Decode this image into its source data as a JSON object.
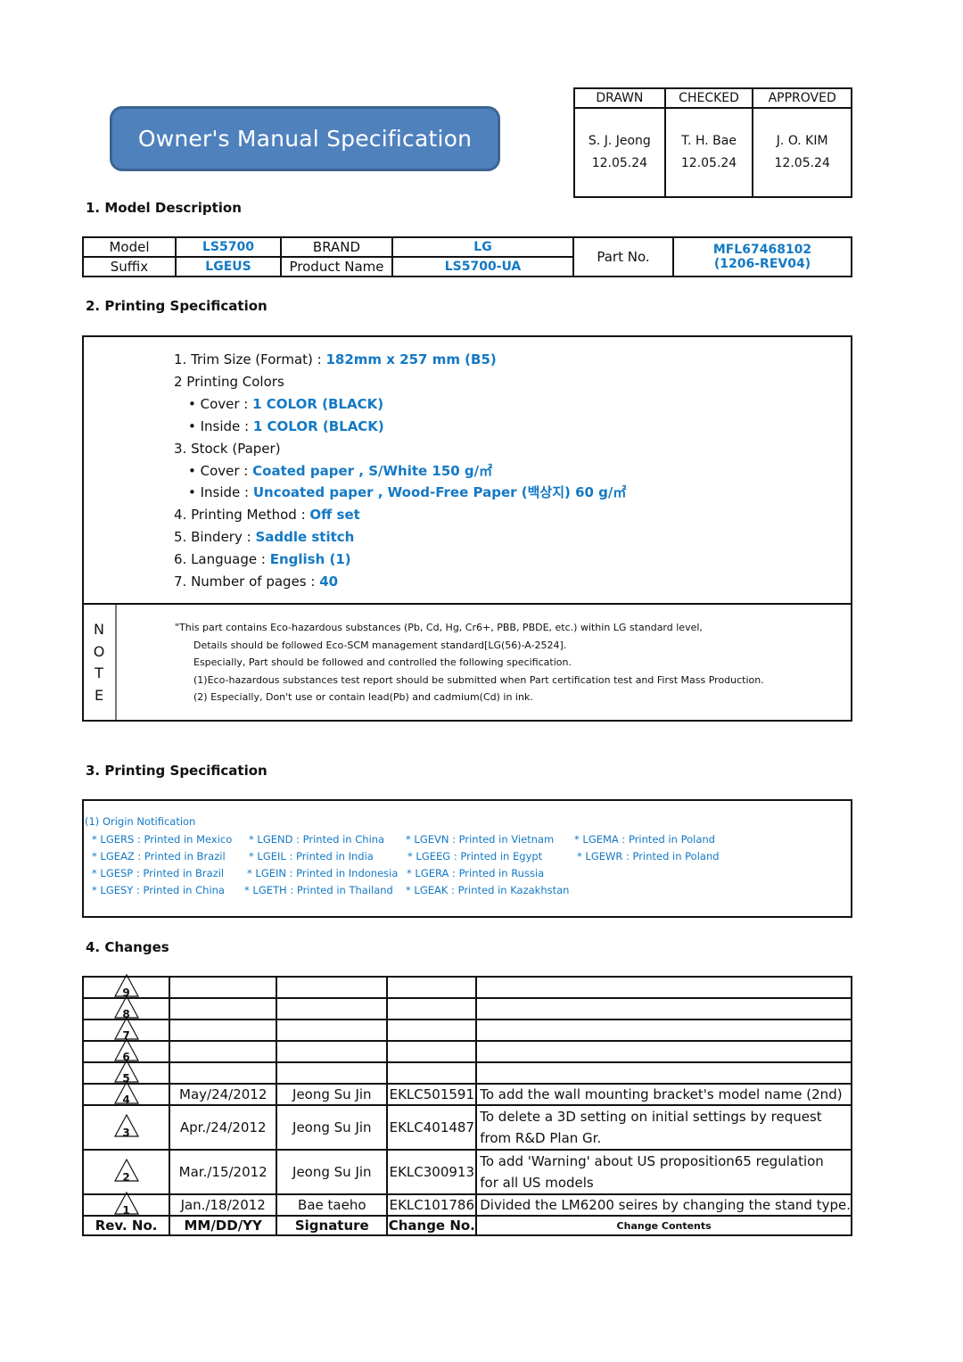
{
  "title": "Owner's Manual Specification",
  "approval": {
    "headers": [
      "DRAWN",
      "CHECKED",
      "APPROVED"
    ],
    "names": [
      "S. J. Jeong",
      "T. H. Bae",
      "J. O. KIM"
    ],
    "dates": [
      "12.05.24",
      "12.05.24",
      "12.05.24"
    ]
  },
  "sections": {
    "model_description": "1. Model Description",
    "printing_spec": "2. Printing Specification",
    "printing_spec_3": "3. Printing Specification",
    "changes": "4. Changes"
  },
  "model": {
    "model_label": "Model",
    "model_value": "LS5700",
    "brand_label": "BRAND",
    "brand_value": "LG",
    "suffix_label": "Suffix",
    "suffix_value": "LGEUS",
    "product_name_label": "Product Name",
    "product_name_value": "LS5700-UA",
    "part_no_label": "Part No.",
    "part_no_value": "MFL67468102",
    "part_no_rev": "(1206-REV04)"
  },
  "spec": {
    "trim_label": "1. Trim Size (Format) : ",
    "trim_value": "182mm x 257 mm (B5)",
    "colors_label": "2 Printing Colors",
    "cover_color_label": "• Cover : ",
    "cover_color_value": "1 COLOR (BLACK)",
    "inside_color_label": "• Inside : ",
    "inside_color_value": "1 COLOR (BLACK)",
    "stock_label": "3. Stock (Paper)",
    "cover_stock_label": "• Cover : ",
    "cover_stock_value": "Coated paper , S/White 150 g/㎡",
    "inside_stock_label": "• Inside : ",
    "inside_stock_value": "Uncoated paper , Wood-Free Paper (백상지) 60 g/㎡",
    "method_label": "4. Printing Method : ",
    "method_value": "Off set",
    "bindery_label": "5. Bindery : ",
    "bindery_value": "Saddle stitch",
    "language_label": "6. Language : ",
    "language_value": "English (1)",
    "pages_label": "7. Number of pages : ",
    "pages_value": "40"
  },
  "note": {
    "letters": [
      "N",
      "O",
      "T",
      "E"
    ],
    "lines": [
      "\"This part contains Eco-hazardous substances (Pb, Cd, Hg, Cr6+, PBB, PBDE, etc.) within LG standard level,",
      "Details should be followed Eco-SCM management standard[LG(56)-A-2524].",
      "Especially, Part should be followed and controlled the following specification.",
      "(1)Eco-hazardous substances test report should be submitted when Part certification test and First Mass Production.",
      "(2) Especially, Don't use or contain lead(Pb) and cadmium(Cd) in ink."
    ]
  },
  "origin": {
    "title": "(1) Origin Notification",
    "rows": [
      [
        "* LGERS : Printed in Mexico",
        "* LGEND : Printed in China",
        "* LGEVN : Printed in Vietnam",
        "* LGEMA : Printed in Poland"
      ],
      [
        "* LGEAZ : Printed in Brazil",
        "* LGEIL : Printed in India",
        "* LGEEG : Printed in Egypt",
        "* LGEWR : Printed in Poland"
      ],
      [
        "* LGESP : Printed in Brazil",
        "* LGEIN : Printed in Indonesia",
        "* LGERA : Printed in Russia"
      ],
      [
        "* LGESY : Printed in China",
        "* LGETH : Printed in Thailand",
        "* LGEAK : Printed in Kazakhstan"
      ]
    ]
  },
  "changes": {
    "rows": [
      {
        "rev": "9",
        "date": "",
        "signature": "",
        "change_no": "",
        "content": ""
      },
      {
        "rev": "8",
        "date": "",
        "signature": "",
        "change_no": "",
        "content": ""
      },
      {
        "rev": "7",
        "date": "",
        "signature": "",
        "change_no": "",
        "content": ""
      },
      {
        "rev": "6",
        "date": "",
        "signature": "",
        "change_no": "",
        "content": ""
      },
      {
        "rev": "5",
        "date": "",
        "signature": "",
        "change_no": "",
        "content": ""
      },
      {
        "rev": "4",
        "date": "May/24/2012",
        "signature": "Jeong Su Jin",
        "change_no": "EKLC501591",
        "content": "To add the wall mounting bracket's model name (2nd)"
      },
      {
        "rev": "3",
        "date": "Apr./24/2012",
        "signature": "Jeong Su Jin",
        "change_no": "EKLC401487",
        "content": "To delete a 3D setting on initial settings by request",
        "content2": "from R&D Plan Gr."
      },
      {
        "rev": "2",
        "date": "Mar./15/2012",
        "signature": "Jeong Su Jin",
        "change_no": "EKLC300913",
        "content": "To add 'Warning' about US proposition65 regulation",
        "content2": "for all US models"
      },
      {
        "rev": "1",
        "date": "Jan./18/2012",
        "signature": "Bae taeho",
        "change_no": "EKLC101786",
        "content": "Divided the LM6200 seires by changing the stand type."
      }
    ],
    "headers": {
      "rev": "Rev. No.",
      "date": "MM/DD/YY",
      "signature": "Signature",
      "change_no": "Change No.",
      "content": "Change Contents"
    }
  }
}
